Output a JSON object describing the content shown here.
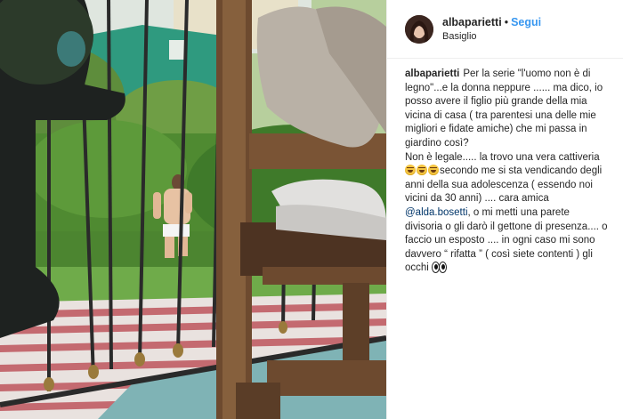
{
  "header": {
    "username": "albaparietti",
    "separator": "•",
    "follow_label": "Segui",
    "location": "Basiglio"
  },
  "caption": {
    "username": "albaparietti",
    "part1": "Per la serie \"l'uomo non è di legno\"...e la donna neppure ...... ma dico, io posso avere il figlio più grande della mia vicina di casa ( tra parentesi una delle mie migliori e fidate amiche) che mi passa in giardino così?",
    "part2": "Non è legale..... la trovo una vera cattiveria",
    "part3": "secondo me si sta vendicando degli anni della sua adolescenza ( essendo noi vicini da 30 anni) .... cara amica",
    "mention": "@alda.bosetti",
    "part4": ", o mi metti una parete divisoria o gli darò il gettone di presenza.... o faccio un esposto .... in ogni caso mi sono davvero “ rifatta ” ( così siete contenti ) gli occhi",
    "emoji_laugh": "laughing-face-icon",
    "emoji_eyes": "eyes-icon"
  },
  "colors": {
    "follow": "#3897f0",
    "mention": "#003569",
    "text": "#262626",
    "divider": "#efefef"
  }
}
